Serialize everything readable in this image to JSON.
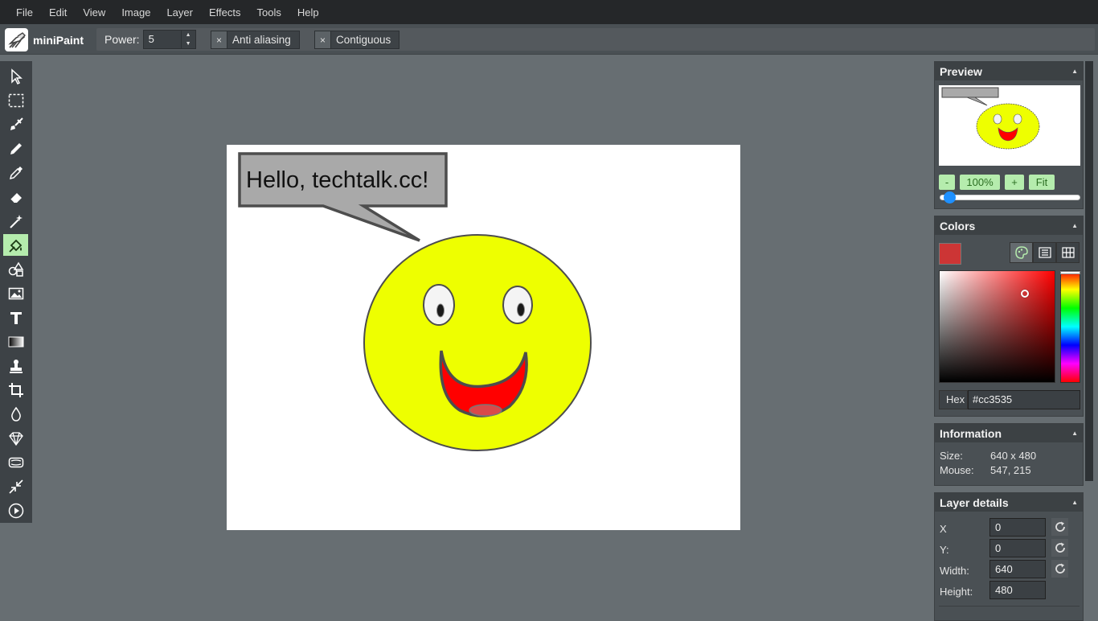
{
  "menu": [
    "File",
    "Edit",
    "View",
    "Image",
    "Layer",
    "Effects",
    "Tools",
    "Help"
  ],
  "app": {
    "name": "miniPaint"
  },
  "options": {
    "power_label": "Power:",
    "power_value": "5",
    "anti_aliasing": "Anti aliasing",
    "contiguous": "Contiguous",
    "close_glyph": "×"
  },
  "tools": [
    {
      "icon": "select-arrow-icon"
    },
    {
      "icon": "selection-rect-icon"
    },
    {
      "icon": "brush-icon"
    },
    {
      "icon": "pencil-icon"
    },
    {
      "icon": "color-picker-icon"
    },
    {
      "icon": "eraser-icon"
    },
    {
      "icon": "magic-wand-icon"
    },
    {
      "icon": "fill-bucket-icon",
      "active": true
    },
    {
      "icon": "shapes-icon"
    },
    {
      "icon": "image-icon"
    },
    {
      "icon": "text-icon"
    },
    {
      "icon": "gradient-icon"
    },
    {
      "icon": "clone-stamp-icon"
    },
    {
      "icon": "crop-icon"
    },
    {
      "icon": "blur-icon"
    },
    {
      "icon": "sharpen-icon"
    },
    {
      "icon": "bulge-pinch-icon"
    },
    {
      "icon": "resize-icon"
    },
    {
      "icon": "animation-play-icon"
    }
  ],
  "canvas": {
    "speech_text": "Hello, techtalk.cc!",
    "face_color": "#eeff00",
    "mouth_color": "#ff0000"
  },
  "preview": {
    "title": "Preview",
    "zoom_out": "-",
    "zoom_value": "100%",
    "zoom_in": "+",
    "fit": "Fit"
  },
  "colors": {
    "title": "Colors",
    "current": "#cc3535",
    "hex_label": "Hex",
    "hex_value": "#cc3535"
  },
  "information": {
    "title": "Information",
    "size_label": "Size:",
    "size_value": "640 x 480",
    "mouse_label": "Mouse:",
    "mouse_value": "547, 215"
  },
  "layer_details": {
    "title": "Layer details",
    "x_label": "X",
    "x_value": "0",
    "y_label": "Y:",
    "y_value": "0",
    "width_label": "Width:",
    "width_value": "640",
    "height_label": "Height:",
    "height_value": "480"
  },
  "accent": "#b5ecad"
}
